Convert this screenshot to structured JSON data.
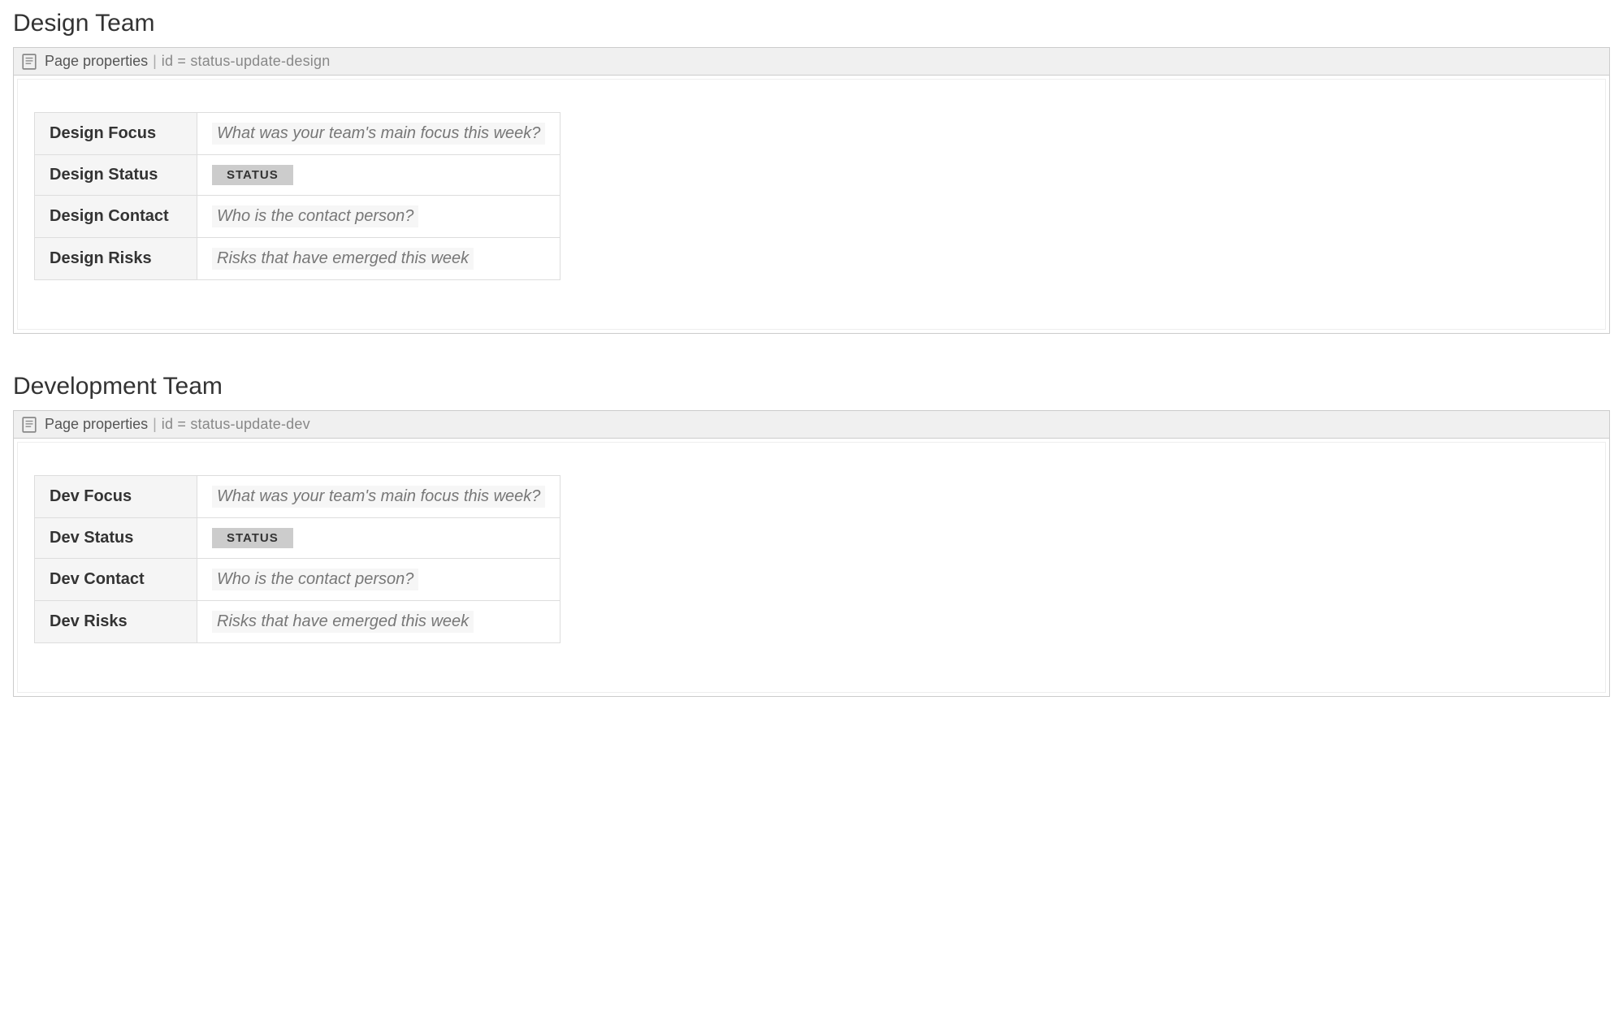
{
  "sections": [
    {
      "title": "Design Team",
      "macro_label": "Page properties",
      "macro_id_prefix": "id = ",
      "macro_id": "status-update-design",
      "rows": [
        {
          "key": "Design Focus",
          "type": "placeholder",
          "value": "What was your team's main focus this week?"
        },
        {
          "key": "Design Status",
          "type": "status",
          "value": "STATUS"
        },
        {
          "key": "Design Contact",
          "type": "placeholder",
          "value": "Who is the contact person?"
        },
        {
          "key": "Design Risks",
          "type": "placeholder",
          "value": "Risks that have emerged this week"
        }
      ]
    },
    {
      "title": "Development Team",
      "macro_label": "Page properties",
      "macro_id_prefix": "id = ",
      "macro_id": "status-update-dev",
      "rows": [
        {
          "key": "Dev Focus",
          "type": "placeholder",
          "value": "What was your team's main focus this week?"
        },
        {
          "key": "Dev Status",
          "type": "status",
          "value": "STATUS"
        },
        {
          "key": "Dev Contact",
          "type": "placeholder",
          "value": "Who is the contact person?"
        },
        {
          "key": "Dev Risks",
          "type": "placeholder",
          "value": "Risks that have emerged this week"
        }
      ]
    }
  ]
}
